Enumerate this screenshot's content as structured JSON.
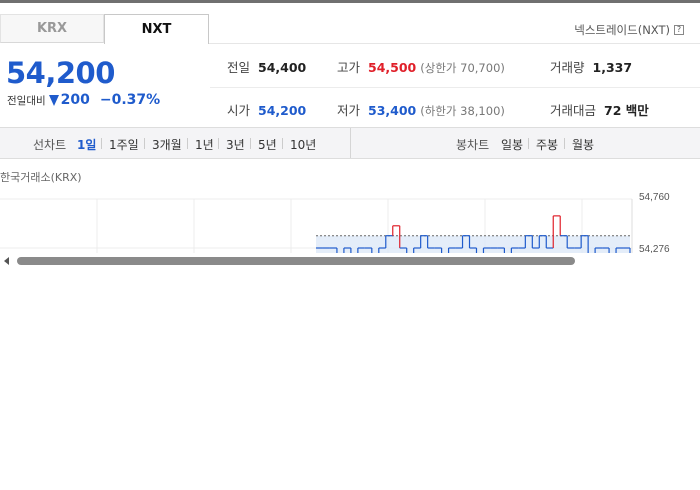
{
  "tabs": {
    "krx": "KRX",
    "nxt": "NXT",
    "active": "NXT"
  },
  "market": {
    "name": "넥스트레이드(NXT)",
    "help": "?"
  },
  "quote": {
    "price": "54,200",
    "change_label": "전일대비",
    "change": "200",
    "direction": "down",
    "change_pct": "−0.37%"
  },
  "stats": {
    "prev_close": {
      "label": "전일",
      "value": "54,400"
    },
    "high": {
      "label": "고가",
      "value": "54,500",
      "sub": "(상한가 70,700)"
    },
    "volume": {
      "label": "거래량",
      "value": "1,337"
    },
    "open": {
      "label": "시가",
      "value": "54,200"
    },
    "low": {
      "label": "저가",
      "value": "53,400",
      "sub": "(하한가 38,100)"
    },
    "amount": {
      "label": "거래대금",
      "value": "72 백만"
    }
  },
  "period_bar": {
    "line_label": "선차트",
    "line_items": [
      "1일",
      "1주일",
      "3개월",
      "1년",
      "3년",
      "5년",
      "10년"
    ],
    "line_active": "1일",
    "candle_label": "봉차트",
    "candle_items": [
      "일봉",
      "주봉",
      "월봉"
    ]
  },
  "chart": {
    "exchange_label": "한국거래소(KRX)",
    "y_labels": [
      "54,760",
      "54,276"
    ]
  },
  "colors": {
    "down": "#1f5bcc",
    "up": "#e0202a",
    "chart_fill": "#dde9f8"
  },
  "chart_data": {
    "type": "line",
    "y_tick_labels": [
      "54,760",
      "54,276"
    ],
    "grid": true,
    "series": [
      {
        "values": [
          54276,
          54276,
          54276,
          54200,
          54276,
          54200,
          54276,
          54276,
          54200,
          54276,
          54400,
          54500,
          54276,
          54200,
          54276,
          54400,
          54276,
          54276,
          54200,
          54276,
          54276,
          54400,
          54276,
          54200,
          54276,
          54276,
          54276,
          54200,
          54276,
          54276,
          54400,
          54276,
          54400,
          54276,
          54600,
          54400,
          54276,
          54276,
          54400,
          54200,
          54276,
          54276,
          54200,
          54276,
          54276,
          54200
        ]
      }
    ]
  }
}
